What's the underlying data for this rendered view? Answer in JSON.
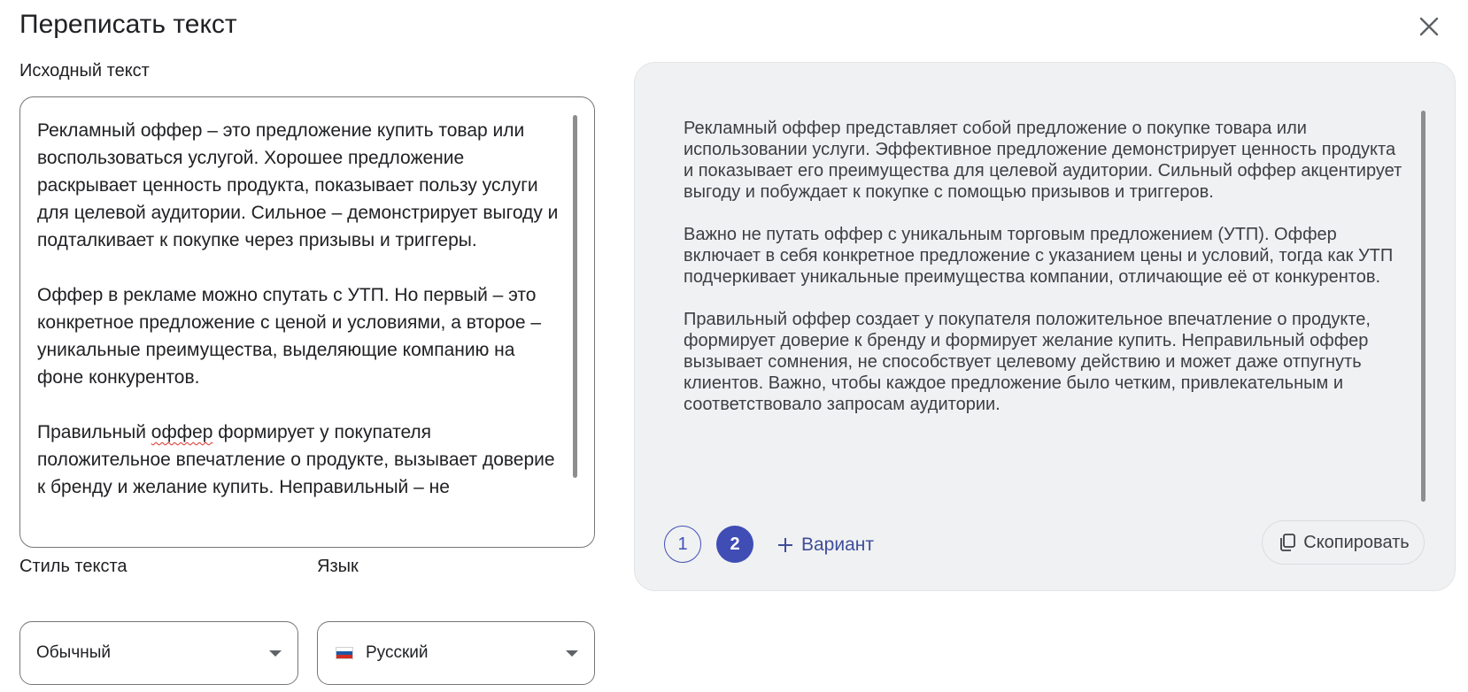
{
  "dialog": {
    "title": "Переписать текст",
    "close_icon": "close-icon"
  },
  "source": {
    "label": "Исходный текст",
    "text_before_misspelling": "Рекламный оффер – это предложение купить товар или воспользоваться услугой. Хорошее предложение раскрывает ценность продукта, показывает пользу услуги для целевой аудитории. Сильное – демонстрирует выгоду и подталкивает к покупке через призывы и триггеры.\n\nОффер в рекламе можно спутать с УТП. Но первый – это конкретное предложение с ценой и условиями, а второе – уникальные преимущества, выделяющие компанию на фоне конкурентов.\n\nПравильный ",
    "misspelled_word": "оффер",
    "text_after_misspelling": " формирует у покупателя положительное впечатление о продукте, вызывает доверие к бренду и желание купить. Неправильный – не"
  },
  "result": {
    "paragraphs": [
      "Рекламный оффер представляет собой предложение о покупке товара или использовании услуги. Эффективное предложение демонстрирует ценность продукта и показывает его преимущества для целевой аудитории. Сильный оффер акцентирует выгоду и побуждает к покупке с помощью призывов и триггеров.",
      "Важно не путать оффер с уникальным торговым предложением (УТП). Оффер включает в себя конкретное предложение с указанием цены и условий, тогда как УТП подчеркивает уникальные преимущества компании, отличающие её от конкурентов.",
      "Правильный оффер создает у покупателя положительное впечатление о продукте, формирует доверие к бренду и формирует желание купить. Неправильный оффер вызывает сомнения, не способствует целевому действию и может даже отпугнуть клиентов. Важно, чтобы каждое предложение было четким, привлекательным и соответствовало запросам аудитории."
    ],
    "variants": [
      "1",
      "2"
    ],
    "selected_variant": "2",
    "add_variant_label": "Вариант",
    "copy_label": "Скопировать"
  },
  "settings": {
    "style_label": "Стиль текста",
    "style_value": "Обычный",
    "language_label": "Язык",
    "language_value": "Русский"
  },
  "colors": {
    "accent": "#3f4db5",
    "panel_bg": "#f0f1f2",
    "border": "#747775"
  }
}
